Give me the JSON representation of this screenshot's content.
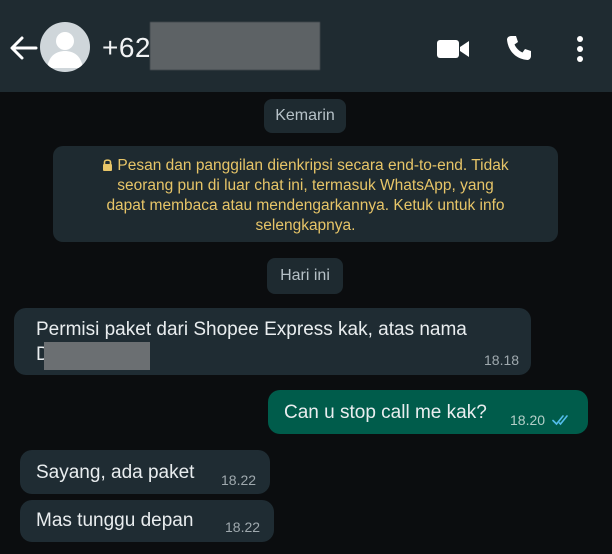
{
  "header": {
    "title": "+628",
    "icons": [
      "back-arrow-icon",
      "avatar",
      "video-call-icon",
      "phone-call-icon",
      "more-vert-icon"
    ]
  },
  "chips": {
    "yesterday": "Kemarin",
    "today": "Hari ini"
  },
  "encryption_notice": {
    "line1": "Pesan dan panggilan dienkripsi secara end-to-end. Tidak",
    "line2": "seorang pun di luar chat ini, termasuk WhatsApp, yang",
    "line3": "dapat membaca atau mendengarkannya. Ketuk untuk info",
    "line4": "selengkapnya.",
    "color": "#e7c568"
  },
  "messages": [
    {
      "direction": "in",
      "line1": "Permisi paket dari Shopee Express kak, atas nama",
      "line2": "D",
      "time": "18.18"
    },
    {
      "direction": "out",
      "text": "Can u stop call me kak?",
      "time": "18.20",
      "status": "read"
    },
    {
      "direction": "in",
      "text": "Sayang, ada paket",
      "time": "18.22"
    },
    {
      "direction": "in",
      "text": "Mas tunggu depan",
      "time": "18.22"
    }
  ],
  "colors": {
    "header_bg": "#1f2b31",
    "chat_bg": "#0b0d0f",
    "incoming_bubble": "#1f2c33",
    "outgoing_bubble": "#005c4b",
    "read_ticks": "#53bdeb"
  }
}
